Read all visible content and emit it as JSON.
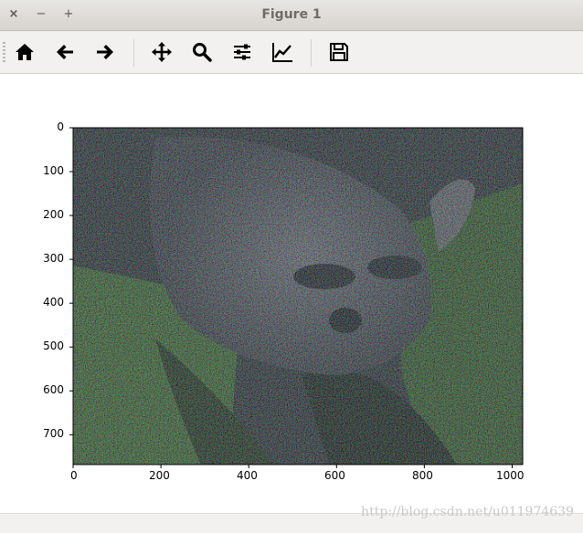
{
  "window": {
    "title": "Figure 1",
    "controls": {
      "close": "×",
      "minimize": "−",
      "maximize": "+"
    }
  },
  "toolbar": {
    "buttons": [
      {
        "name": "home",
        "icon": "home-icon"
      },
      {
        "name": "back",
        "icon": "arrow-left-icon"
      },
      {
        "name": "forward",
        "icon": "arrow-right-icon"
      },
      {
        "name": "pan",
        "icon": "move-icon"
      },
      {
        "name": "zoom",
        "icon": "magnifier-icon"
      },
      {
        "name": "subplots",
        "icon": "sliders-icon"
      },
      {
        "name": "edit-axes",
        "icon": "line-chart-icon"
      },
      {
        "name": "save",
        "icon": "floppy-disk-icon"
      }
    ]
  },
  "figure": {
    "image_description_colors": {
      "foliage": "#3f6a2a",
      "noise_mix": [
        "#ff00ff",
        "#00ffff",
        "#ffff00",
        "#ff0000",
        "#00ff00",
        "#0000ff"
      ]
    },
    "x_ticks": [
      "0",
      "200",
      "400",
      "600",
      "800",
      "1000"
    ],
    "y_ticks": [
      "0",
      "100",
      "200",
      "300",
      "400",
      "500",
      "600",
      "700"
    ],
    "xlim": [
      0,
      1024
    ],
    "ylim": [
      768,
      0
    ]
  },
  "watermark": "http://blog.csdn.net/u011974639"
}
